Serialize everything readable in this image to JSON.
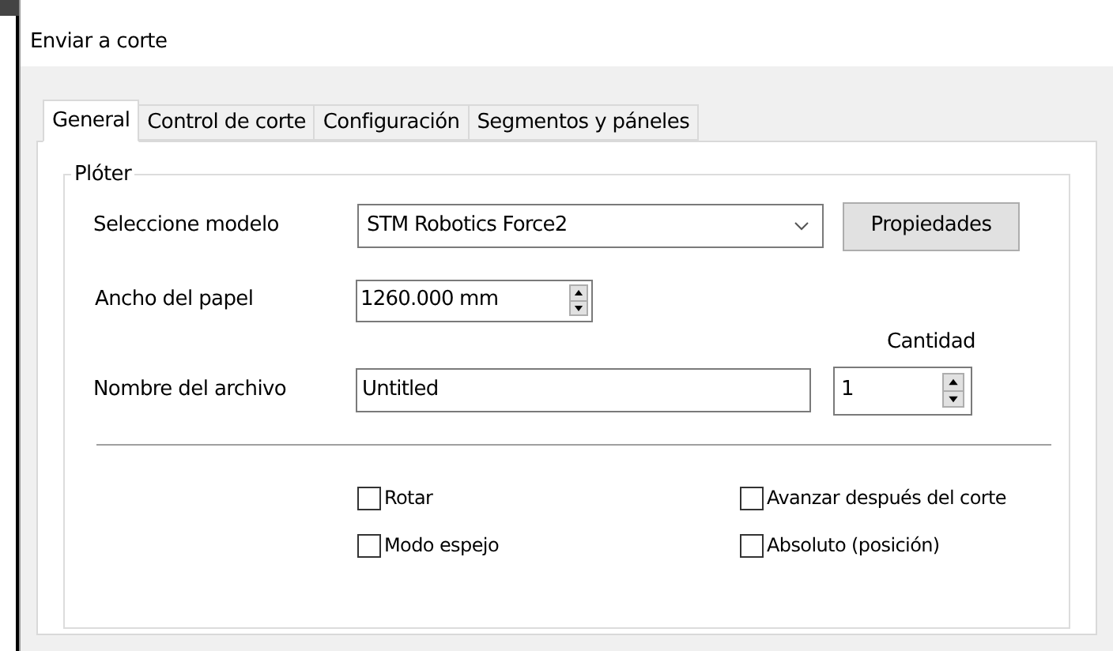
{
  "window": {
    "title": "Enviar a corte"
  },
  "tabs": [
    {
      "label": "General",
      "selected": true
    },
    {
      "label": "Control de corte",
      "selected": false
    },
    {
      "label": "Configuración",
      "selected": false
    },
    {
      "label": "Segmentos y páneles",
      "selected": false
    }
  ],
  "group": {
    "title": "Plóter"
  },
  "model": {
    "label": "Seleccione modelo",
    "value": "STM Robotics Force2"
  },
  "properties_button": "Propiedades",
  "paper_width": {
    "label": "Ancho del papel",
    "value": "1260.000 mm"
  },
  "quantity": {
    "label": "Cantidad",
    "value": "1"
  },
  "file_name": {
    "label": "Nombre del archivo",
    "value": "Untitled"
  },
  "checkboxes": [
    {
      "label": "Rotar",
      "checked": false
    },
    {
      "label": "Avanzar después del corte",
      "checked": false
    },
    {
      "label": "Modo espejo",
      "checked": false
    },
    {
      "label": "Absoluto (posición)",
      "checked": false
    }
  ]
}
